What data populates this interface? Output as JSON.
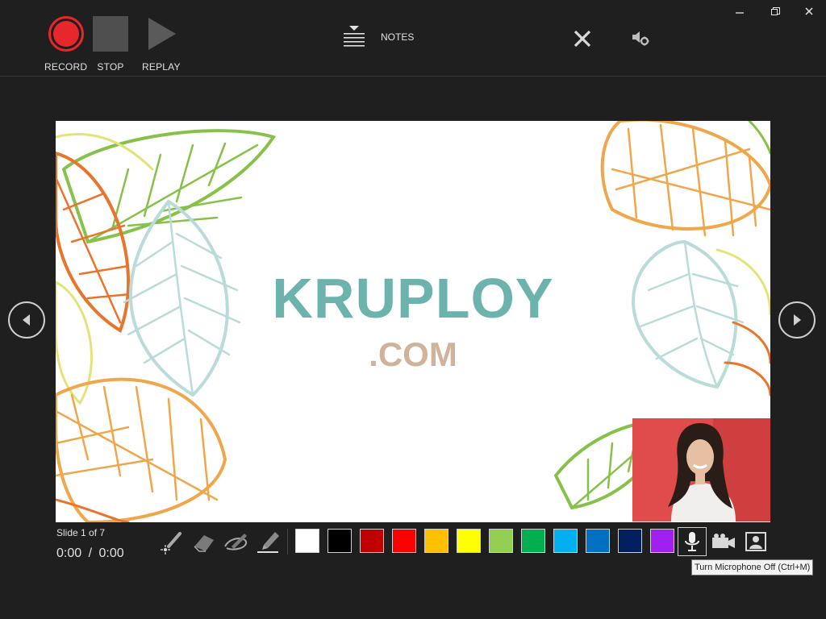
{
  "window": {
    "minimize_glyph": "−",
    "restore_glyph": "❐",
    "close_glyph": "✕"
  },
  "toolbar": {
    "record_label": "RECORD",
    "stop_label": "STOP",
    "replay_label": "REPLAY",
    "notes_label": "NOTES",
    "record_color": "#e8272d"
  },
  "slide": {
    "title": "KRUPLOY",
    "subtitle": ".COM",
    "title_color": "#6bb3ac",
    "subtitle_color": "#d1b39a"
  },
  "status": {
    "slide_counter": "Slide 1 of 7",
    "elapsed": "0:00",
    "separator": "/",
    "total": "0:00"
  },
  "pen_tools": [
    "laser-pointer-icon",
    "eraser-icon",
    "pen-icon",
    "highlighter-icon"
  ],
  "colors": [
    "#ffffff",
    "#000000",
    "#c00000",
    "#ff0000",
    "#ffc000",
    "#ffff00",
    "#92d050",
    "#00b050",
    "#00b0f0",
    "#0070c0",
    "#002060",
    "#a020f0"
  ],
  "media": [
    "microphone-icon",
    "camera-icon",
    "camera-preview-icon"
  ],
  "tooltip": "Turn Microphone Off (Ctrl+M)"
}
